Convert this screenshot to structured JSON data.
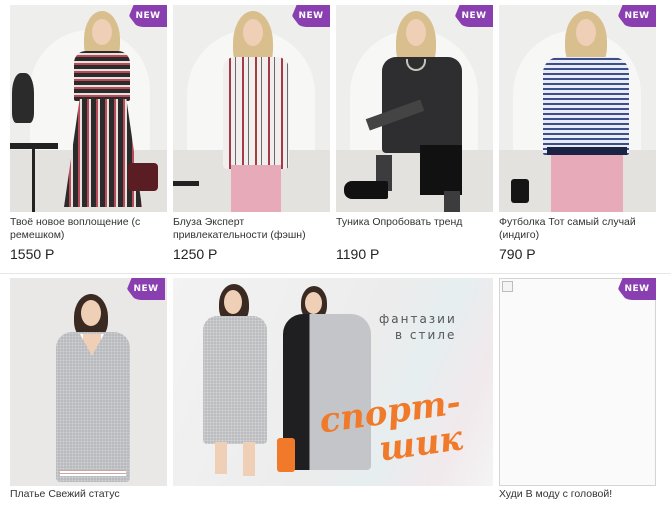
{
  "badge_label": "NEW",
  "colors": {
    "badge": "#8a3fb1",
    "promo_orange": "#f07a2a"
  },
  "products_row1": [
    {
      "title": "Твоё новое воплощение (с ремешком)",
      "price": "1550 Р"
    },
    {
      "title": "Блуза Эксперт привлекательности (фэшн)",
      "price": "1250 Р"
    },
    {
      "title": "Туника Опробовать тренд",
      "price": "1190 Р"
    },
    {
      "title": "Футболка Тот самый случай (индиго)",
      "price": "790 Р"
    }
  ],
  "products_row2": [
    {
      "title": "Платье Свежий статус"
    },
    {
      "title": "Худи В моду с головой!"
    }
  ],
  "promo": {
    "tagline_line1": "фантазии",
    "tagline_line2": "в стиле",
    "headline_line1": "спорт-",
    "headline_line2": "шик"
  }
}
